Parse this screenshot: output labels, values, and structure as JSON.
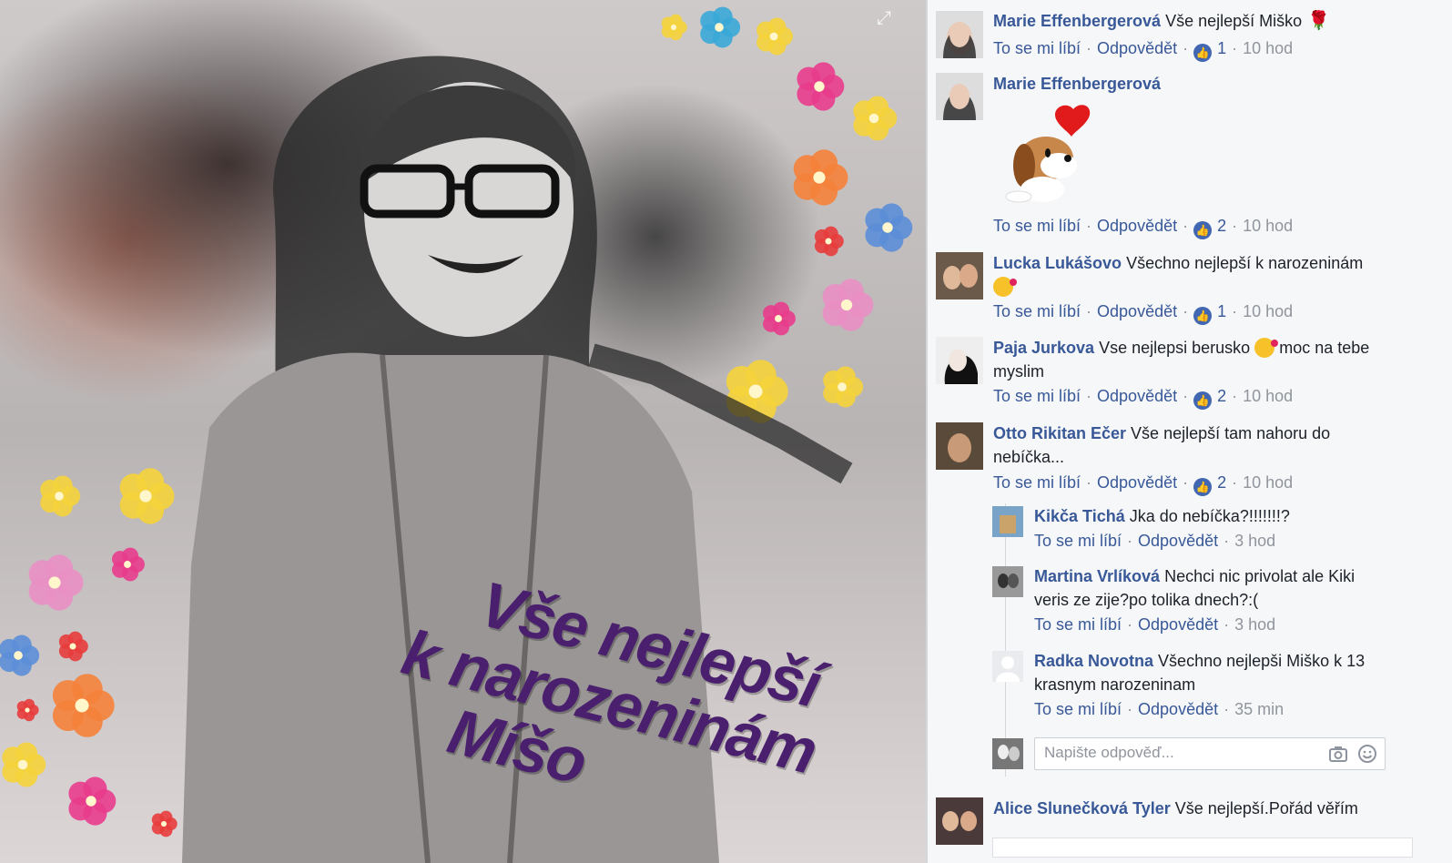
{
  "photo": {
    "expand_icon": "expand-arrows-icon",
    "overlay_lines": [
      "Vše nejlepší",
      "k narozeninám",
      "Míšo"
    ]
  },
  "comments": [
    {
      "author": "Marie Effenbergerová",
      "text": "Vše nejlepší Miško",
      "like": "To se mi líbí",
      "reply": "Odpovědět",
      "likes": "1",
      "time": "10 hod"
    },
    {
      "author": "Marie Effenbergerová",
      "text": "",
      "like": "To se mi líbí",
      "reply": "Odpovědět",
      "likes": "2",
      "time": "10 hod"
    },
    {
      "author": "Lucka Lukášovo",
      "text": "Všechno nejlepší k narozeninám",
      "like": "To se mi líbí",
      "reply": "Odpovědět",
      "likes": "1",
      "time": "10 hod"
    },
    {
      "author": "Paja Jurkova",
      "text": "Vse nejlepsi berusko",
      "text2": "moc na tebe myslim",
      "like": "To se mi líbí",
      "reply": "Odpovědět",
      "likes": "2",
      "time": "10 hod"
    },
    {
      "author": "Otto Rikitan Ečer",
      "text": "Vše nejlepší tam nahoru do nebíčka...",
      "like": "To se mi líbí",
      "reply": "Odpovědět",
      "likes": "2",
      "time": "10 hod"
    }
  ],
  "replies": [
    {
      "author": "Kikča Tichá",
      "text": "Jka do nebíčka?!!!!!!!?",
      "like": "To se mi líbí",
      "reply": "Odpovědět",
      "time": "3 hod"
    },
    {
      "author": "Martina Vrlíková",
      "text": "Nechci nic privolat ale Kiki veris ze zije?po tolika dnech?:(",
      "like": "To se mi líbí",
      "reply": "Odpovědět",
      "time": "3 hod"
    },
    {
      "author": "Radka Novotna",
      "text": "Všechno nejlepši Miško k 13 krasnym narozeninam",
      "like": "To se mi líbí",
      "reply": "Odpovědět",
      "time": "35 min"
    }
  ],
  "reply_input": {
    "placeholder": "Napište odpověď..."
  },
  "last_comment": {
    "author": "Alice Slunečková Tyler",
    "text": "Vše nejlepší.Pořád věřím"
  },
  "colors": {
    "link": "#385898",
    "overlay_text": "#4a1f6e",
    "like_badge": "#4267b2"
  }
}
